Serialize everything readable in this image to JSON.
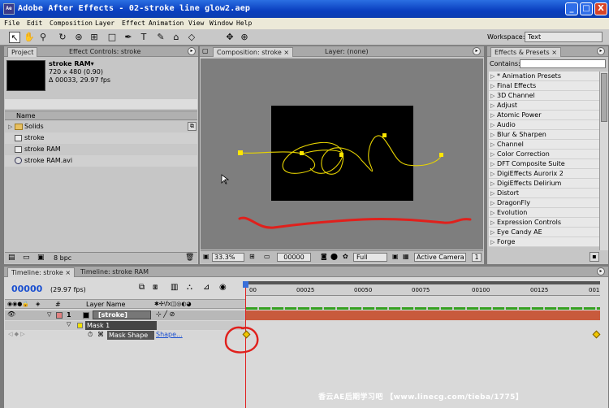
{
  "window": {
    "title": "Adobe After Effects - 02-stroke line glow2.aep",
    "app_icon": "after-effects-icon",
    "buttons": [
      "_",
      "□",
      "X"
    ]
  },
  "menu": [
    "File",
    "Edit",
    "Composition",
    "Layer",
    "Effect",
    "Animation",
    "View",
    "Window",
    "Help"
  ],
  "workspace": {
    "label": "Workspace:",
    "value": "Text"
  },
  "project": {
    "tabs": [
      "Project",
      "Effect Controls: stroke"
    ],
    "selected_name": "stroke RAM▾",
    "info_line1": "720 x 480 (0.90)",
    "info_line2": "Δ 00033, 29.97 fps",
    "column_name": "Name",
    "items": [
      "Solids",
      "stroke",
      "stroke RAM",
      "stroke RAM.avi"
    ],
    "bpc": "8 bpc"
  },
  "composition": {
    "tabs": [
      "Composition: stroke",
      "Layer: (none)"
    ],
    "zoom": "33.3%",
    "timecode": "00000",
    "resolution": "Full",
    "camera": "Active Camera",
    "views": "1"
  },
  "effects": {
    "tab": "Effects & Presets",
    "contains_label": "Contains:",
    "categories": [
      "* Animation Presets",
      "Final Effects",
      "3D Channel",
      "Adjust",
      "Atomic Power",
      "Audio",
      "Blur & Sharpen",
      "Channel",
      "Color Correction",
      "DFT Composite Suite",
      "DigiEffects Aurorix 2",
      "DigiEffects Delirium",
      "Distort",
      "DragonFly",
      "Evolution",
      "Expression Controls",
      "Eye Candy AE",
      "Forge"
    ]
  },
  "timeline": {
    "tabs": [
      "Timeline: stroke",
      "Timeline: stroke RAM"
    ],
    "timecode": "00000",
    "fps": "(29.97 fps)",
    "col_hash": "#",
    "col_layer_name": "Layer Name",
    "layer_num": "1",
    "layer_name": "[stroke]",
    "mask": "Mask 1",
    "mask_shape": "Mask Shape",
    "shape_link": "Shape...",
    "ruler": [
      "00",
      "00025",
      "00050",
      "00075",
      "00100",
      "00125",
      "001"
    ]
  },
  "watermark": "香云AE后期学习吧 【www.linecg.com/tieba/1775】",
  "colors": {
    "annotation_red": "#e0201c",
    "stroke_yellow": "#e8d400",
    "layer_bar": "#c85a3c"
  }
}
